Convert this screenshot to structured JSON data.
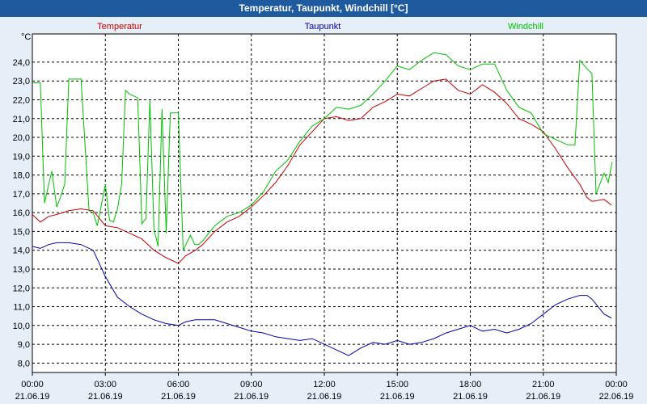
{
  "window": {
    "title": "Temperatur, Taupunkt, Windchill [°C]"
  },
  "chart_data": {
    "type": "line",
    "title": "Temperatur, Taupunkt, Windchill [°C]",
    "ylabel": "°C",
    "ylim": [
      7.5,
      25.5
    ],
    "yticks": [
      8.0,
      9.0,
      10.0,
      11.0,
      12.0,
      13.0,
      14.0,
      15.0,
      16.0,
      17.0,
      18.0,
      19.0,
      20.0,
      21.0,
      22.0,
      23.0,
      24.0
    ],
    "ytick_labels": [
      "8,0",
      "9,0",
      "10,0",
      "11,0",
      "12,0",
      "13,0",
      "14,0",
      "15,0",
      "16,0",
      "17,0",
      "18,0",
      "19,0",
      "20,0",
      "21,0",
      "22,0",
      "23,0",
      "24,0"
    ],
    "xlim": [
      0,
      24
    ],
    "xticks": [
      0,
      3,
      6,
      9,
      12,
      15,
      18,
      21,
      24
    ],
    "xtick_labels": [
      [
        "00:00",
        "21.06.19"
      ],
      [
        "03:00",
        "21.06.19"
      ],
      [
        "06:00",
        "21.06.19"
      ],
      [
        "09:00",
        "21.06.19"
      ],
      [
        "12:00",
        "21.06.19"
      ],
      [
        "15:00",
        "21.06.19"
      ],
      [
        "18:00",
        "21.06.19"
      ],
      [
        "21:00",
        "21.06.19"
      ],
      [
        "00:00",
        "22.06.19"
      ]
    ],
    "grid": true,
    "series": [
      {
        "name": "Temperatur",
        "color": "#c80000",
        "x": [
          0,
          0.33,
          0.67,
          1,
          1.5,
          2,
          2.5,
          3,
          3.5,
          4,
          4.5,
          5,
          5.5,
          6,
          6.3,
          6.7,
          7,
          7.5,
          8,
          8.5,
          9,
          9.5,
          10,
          10.5,
          11,
          11.5,
          12,
          12.5,
          13,
          13.5,
          14,
          14.5,
          15,
          15.5,
          16,
          16.5,
          17,
          17.5,
          18,
          18.5,
          19,
          19.5,
          20,
          20.5,
          21,
          21.5,
          22,
          22.5,
          22.8,
          23,
          23.5,
          23.8
        ],
        "values": [
          15.9,
          15.5,
          15.8,
          15.9,
          16.1,
          16.2,
          16.1,
          15.3,
          15.2,
          14.9,
          14.6,
          14.0,
          13.6,
          13.3,
          13.7,
          14.0,
          14.3,
          15.0,
          15.5,
          15.8,
          16.3,
          16.9,
          17.6,
          18.5,
          19.6,
          20.3,
          21.0,
          21.1,
          20.9,
          21.0,
          21.6,
          21.9,
          22.3,
          22.2,
          22.6,
          23.0,
          23.1,
          22.5,
          22.3,
          22.8,
          22.4,
          21.8,
          21.0,
          20.7,
          20.3,
          19.4,
          18.4,
          17.5,
          16.8,
          16.6,
          16.7,
          16.4
        ]
      },
      {
        "name": "Taupunkt",
        "color": "#0000b4",
        "x": [
          0,
          0.33,
          0.67,
          1,
          1.5,
          2,
          2.5,
          3,
          3.5,
          4,
          4.5,
          5,
          5.5,
          6,
          6.3,
          6.7,
          7,
          7.5,
          8,
          8.5,
          9,
          9.5,
          10,
          10.5,
          11,
          11.5,
          12,
          12.5,
          13,
          13.5,
          14,
          14.5,
          15,
          15.5,
          16,
          16.5,
          17,
          17.5,
          18,
          18.5,
          19,
          19.5,
          20,
          20.5,
          21,
          21.5,
          22,
          22.5,
          22.8,
          23,
          23.5,
          23.8
        ],
        "values": [
          14.2,
          14.1,
          14.3,
          14.4,
          14.4,
          14.3,
          14.0,
          12.6,
          11.5,
          11.0,
          10.6,
          10.3,
          10.1,
          10.0,
          10.2,
          10.3,
          10.3,
          10.3,
          10.1,
          9.9,
          9.7,
          9.6,
          9.4,
          9.3,
          9.2,
          9.3,
          9.0,
          8.7,
          8.4,
          8.8,
          9.1,
          9.0,
          9.2,
          9.0,
          9.1,
          9.3,
          9.6,
          9.8,
          10.0,
          9.7,
          9.8,
          9.6,
          9.8,
          10.1,
          10.6,
          11.1,
          11.4,
          11.6,
          11.6,
          11.4,
          10.6,
          10.4
        ]
      },
      {
        "name": "Windchill",
        "color": "#00c000",
        "x": [
          0,
          0.33,
          0.5,
          0.67,
          0.8,
          1,
          1.15,
          1.33,
          1.5,
          1.67,
          2,
          2.33,
          2.5,
          2.67,
          3,
          3.17,
          3.33,
          3.5,
          3.67,
          3.83,
          4,
          4.33,
          4.5,
          4.67,
          4.83,
          5,
          5.17,
          5.33,
          5.5,
          5.67,
          5.83,
          6,
          6.2,
          6.5,
          6.67,
          6.83,
          7,
          7.5,
          8,
          8.5,
          9,
          9.5,
          10,
          10.5,
          11,
          11.5,
          12,
          12.5,
          13,
          13.5,
          14,
          14.5,
          15,
          15.5,
          16,
          16.5,
          17,
          17.5,
          18,
          18.5,
          19,
          19.5,
          20,
          20.5,
          21,
          21.5,
          22,
          22.3,
          22.5,
          22.83,
          23,
          23.17,
          23.5,
          23.67,
          23.83
        ],
        "values": [
          22.9,
          22.9,
          16.5,
          17.5,
          18.2,
          16.3,
          16.8,
          17.5,
          23.1,
          23.1,
          23.1,
          16.1,
          16.0,
          15.3,
          17.5,
          15.6,
          15.5,
          16.2,
          17.5,
          22.5,
          22.3,
          22.1,
          15.4,
          15.7,
          22.0,
          15.1,
          14.2,
          21.5,
          14.9,
          21.3,
          21.3,
          21.3,
          14.0,
          14.8,
          14.3,
          14.3,
          14.5,
          15.3,
          15.8,
          16.0,
          16.4,
          17.1,
          18.2,
          18.8,
          19.8,
          20.6,
          21.0,
          21.6,
          21.5,
          21.7,
          22.3,
          23.0,
          23.8,
          23.6,
          24.1,
          24.5,
          24.4,
          23.8,
          23.6,
          23.9,
          23.9,
          22.5,
          21.6,
          21.3,
          20.2,
          19.9,
          19.6,
          19.6,
          24.1,
          23.6,
          23.4,
          17.0,
          18.1,
          17.6,
          18.7
        ]
      }
    ]
  }
}
